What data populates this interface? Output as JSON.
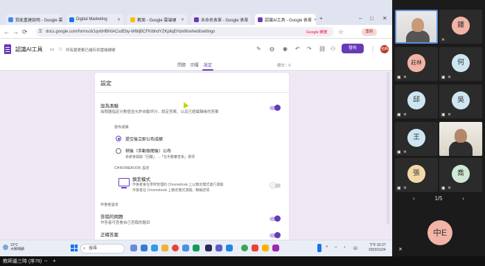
{
  "browser": {
    "tabs": [
      {
        "label": "質能重建說明 - Google 雲端硬",
        "color": "#4285f4"
      },
      {
        "label": "Digital Marketing",
        "color": "#1a73e8"
      },
      {
        "label": "教案 - Google 雲端硬",
        "color": "#fbbc04"
      },
      {
        "label": "未命名表單 - Google 表單",
        "color": "#673ab7"
      },
      {
        "label": "認識AI工具 - Google 表單",
        "color": "#673ab7"
      }
    ],
    "url": "docs.google.com/forms/d/1qvbHBNIACsdEby-W6iljBCFKIbhdYZKpllqEHze9trwheditsettings",
    "google_badge": "Google 帳號",
    "profile_label": "重新"
  },
  "forms": {
    "title": "認識AI工具",
    "saved": "所有變更都已儲存到雲端硬碟",
    "publish_label": "發布",
    "avatar": "名師",
    "tabs": [
      "問題",
      "回覆",
      "設定"
    ],
    "zoom": "總分：0",
    "card": {
      "title": "設定",
      "quiz_title": "設為測驗",
      "quiz_desc": "為問題指定分數值並允許自動評分，設定答案、以及已經編輯後的答案",
      "release_header": "發布成績",
      "release_opt1": "提交後立即公布成績",
      "release_opt2": "稍後（手動檢閱後）公布",
      "release_opt2_sub": "系統會開啟「回覆」→「在手動審查後」選項",
      "chromebook_header": "CHROMEBOOK 設定",
      "locked_title": "鎖定模式",
      "locked_desc1": "作答者會在學校管理的 Chromebook 上以鎖定模式進行測驗",
      "locked_desc2": "作答者在 Chromebook 上鎖定模式測驗。瞭解詳情",
      "respondent_header": "作答者設定",
      "missed_title": "答錯的問題",
      "missed_desc": "作答者可查看自己答錯的題目",
      "correct_title": "正確答案"
    }
  },
  "taskbar": {
    "weather_temp": "23°C",
    "weather_text": "大致晴朗",
    "search_placeholder": "搜尋",
    "time": "下午 02:27",
    "date": "2023/11/24"
  },
  "bottom": {
    "caption": "教師邊三時 (序78)"
  },
  "participants": {
    "tiles": [
      {
        "name": "鍾",
        "color": "#f2b4a6"
      },
      {
        "name": "莊林",
        "color": "#f2b4a6"
      },
      {
        "name": "何",
        "color": "#cde6f2"
      },
      {
        "name": "邱",
        "color": "#cde6f2"
      },
      {
        "name": "吳",
        "color": "#cde6f2"
      },
      {
        "name": "王",
        "color": "#cde6f2"
      },
      {
        "name": "張",
        "color": "#f4d9a6"
      },
      {
        "name": "喬",
        "color": "#cfe9d6"
      }
    ],
    "pager": "1/5",
    "big_avatar": "中E"
  }
}
